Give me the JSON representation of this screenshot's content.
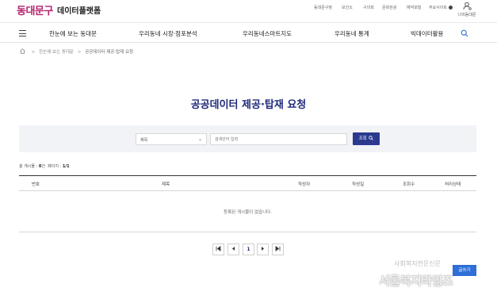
{
  "header": {
    "logo": "동대문구",
    "platform_title": "데이터플랫폼",
    "utility_links": [
      "동대문구청",
      "보건소",
      "구의회",
      "문화관광",
      "예약포털"
    ],
    "language_label": "주요사이트",
    "mypage_label": "나의동대문"
  },
  "nav": {
    "items": [
      "한눈에 보는 동대문",
      "우리동네 시장·점포분석",
      "우리동네스마트지도",
      "우리동네 통계",
      "빅데이터활용"
    ]
  },
  "breadcrumb": {
    "items": [
      "한눈에 보는 동대문",
      "공공데이터 제공·탑재 요청"
    ]
  },
  "page": {
    "title": "공공데이터 제공·탑재 요청"
  },
  "search": {
    "select_value": "제목",
    "input_placeholder": "검색단어 입력",
    "button_label": "조회"
  },
  "summary": {
    "total_label": "총 게시물 : ",
    "total_value": "0",
    "total_unit": "건",
    "page_label": "페이지 : ",
    "page_value": "1/1"
  },
  "table": {
    "columns": [
      "번호",
      "제목",
      "작성자",
      "작성일",
      "조회수",
      "처리상태"
    ],
    "empty_message": "등록된 게시물이 없습니다."
  },
  "pagination": {
    "current": "1"
  },
  "floating": {
    "write_label": "글쓰기"
  },
  "watermark": {
    "line1": "사회복지전문신문",
    "line2": "서울복지타임즈"
  },
  "colors": {
    "brand": "#b5226e",
    "primary": "#2b3a8e",
    "title": "#1f2a7a",
    "panel": "#f1f3f7"
  }
}
